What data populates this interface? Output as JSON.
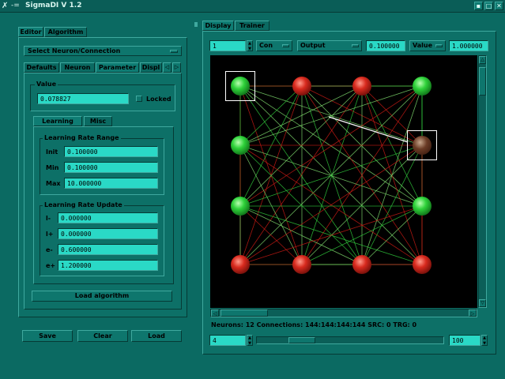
{
  "window": {
    "title": "SigmaDI V 1.2"
  },
  "left_tabs": [
    "Editor",
    "Algorithm"
  ],
  "select_neuron": "Select Neuron/Connection",
  "sub_tabs": [
    "Defaults",
    "Neuron",
    "Parameter",
    "Displ"
  ],
  "value_group": {
    "title": "Value",
    "value": "0.078827",
    "locked_label": "Locked"
  },
  "lr_tabs": [
    "Learning Rate",
    "Misc"
  ],
  "lr_range": {
    "title": "Learning Rate Range",
    "rows": [
      {
        "label": "Init",
        "value": "0.100000"
      },
      {
        "label": "Min",
        "value": "0.100000"
      },
      {
        "label": "Max",
        "value": "10.000000"
      }
    ]
  },
  "lr_update": {
    "title": "Learning Rate Update",
    "rows": [
      {
        "label": "l-",
        "value": "0.000000"
      },
      {
        "label": "l+",
        "value": "0.000000"
      },
      {
        "label": "e-",
        "value": "0.600000"
      },
      {
        "label": "e+",
        "value": "1.200000"
      }
    ]
  },
  "load_algorithm": "Load algorithm",
  "bottom_buttons": [
    "Save",
    "Clear",
    "Load"
  ],
  "right_tabs": [
    "Display",
    "Trainer"
  ],
  "display_controls": {
    "spin1": "1",
    "con": "Con",
    "output": "Output",
    "thr": "0.100000",
    "value_sel": "Value",
    "value_num": "1.000000"
  },
  "status": "Neurons: 12  Connections: 144:144:144:144 SRC: 0 TRG: 0",
  "bottom_controls": {
    "spin_left": "4",
    "spin_right": "100",
    "slider_fraction": 0.2
  },
  "colors": {
    "bg": "#0b6a62",
    "field": "#2ad9c6",
    "accent_green": "#2fd23a",
    "accent_red": "#d82a1e"
  },
  "icons": {
    "close": "close-icon",
    "maximize": "maximize-icon",
    "minimize": "minimize-icon"
  }
}
